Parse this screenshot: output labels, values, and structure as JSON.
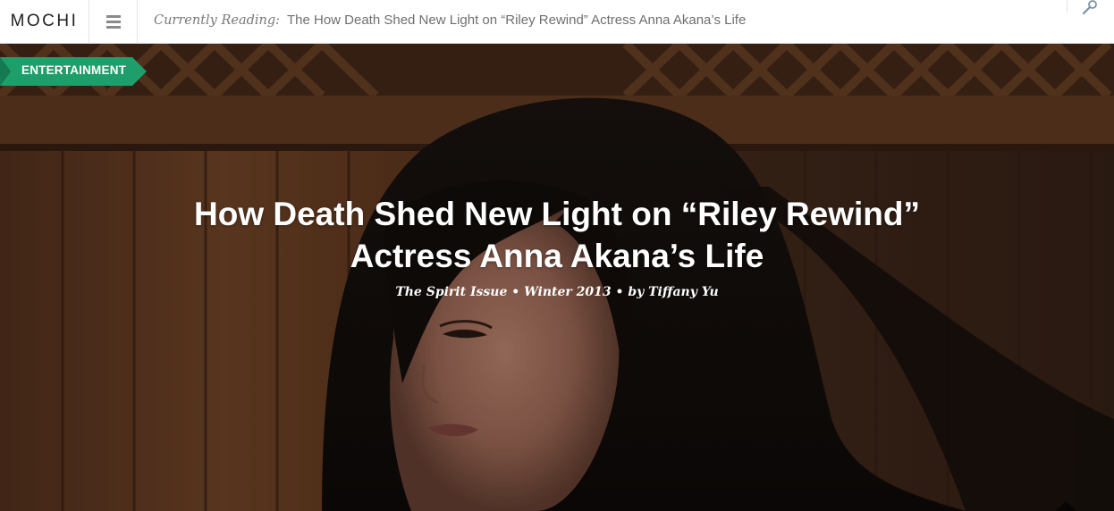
{
  "header": {
    "logo": "MOCHI",
    "currently_reading_label": "Currently Reading:",
    "currently_reading_title": "The How Death Shed New Light on “Riley Rewind” Actress Anna Akana’s Life",
    "menu_icon": "hamburger-menu-icon",
    "search_icon": "search-magnifier-icon"
  },
  "hero": {
    "category": "ENTERTAINMENT",
    "title_line1": "How Death Shed New Light on “Riley Rewind”",
    "title_line2": "Actress Anna Akana’s Life",
    "issue": "The Spirit Issue",
    "separator1": "•",
    "season": "Winter 2013",
    "separator2": "•",
    "author": "by Tiffany Yu"
  },
  "colors": {
    "badge_green": "#1e9e6b",
    "badge_green_dark": "#157a52",
    "header_text": "#6f6f6f"
  }
}
